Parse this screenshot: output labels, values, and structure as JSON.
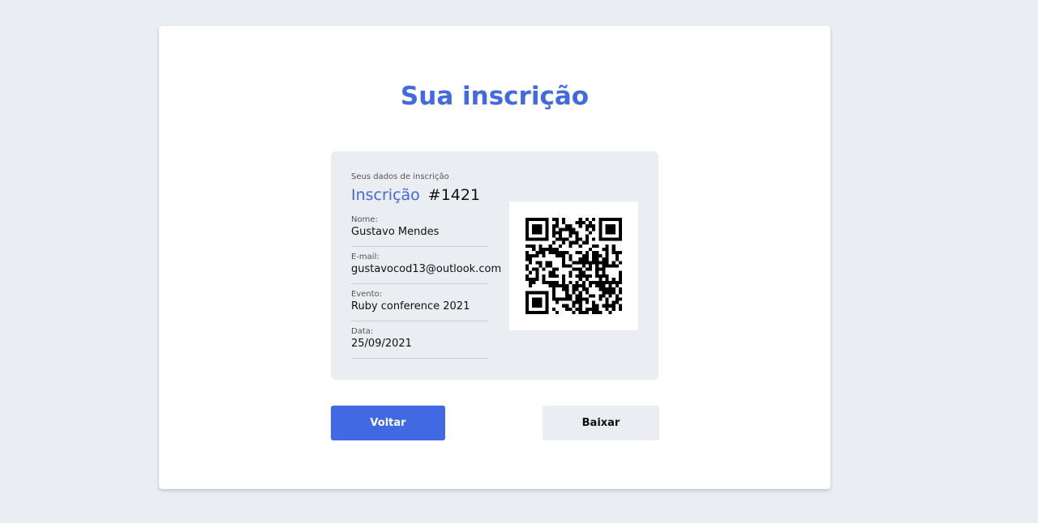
{
  "colors": {
    "page_background": "#eaedf2",
    "card_background": "#ffffff",
    "accent": "#4169e1",
    "panel_background": "#eaedf2"
  },
  "page": {
    "title": "Sua inscrição"
  },
  "registration": {
    "section_label": "Seus dados de inscrição",
    "heading_word": "Inscrição",
    "number": "#1421",
    "fields": [
      {
        "label": "Nome:",
        "value": "Gustavo Mendes"
      },
      {
        "label": "E-mail:",
        "value": "gustavocod13@outlook.com"
      },
      {
        "label": "Evento:",
        "value": "Ruby conference 2021"
      },
      {
        "label": "Data:",
        "value": "25/09/2021"
      }
    ],
    "qr_icon": "qr-code-icon"
  },
  "actions": {
    "back_label": "Voltar",
    "download_label": "Baixar"
  }
}
